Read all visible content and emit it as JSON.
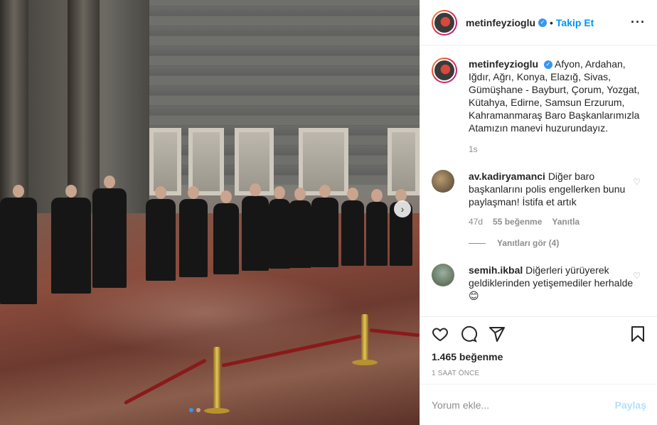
{
  "post": {
    "username": "metinfeyzioglu",
    "follow_label": "Takip Et",
    "more_icon": "more-options-icon",
    "separator": "•"
  },
  "caption": {
    "username": "metinfeyzioglu",
    "text": "Afyon, Ardahan, Iğdır, Ağrı, Konya, Elazığ, Sivas, Gümüşhane - Bayburt, Çorum, Yozgat, Kütahya, Edirne, Samsun Erzurum, Kahramanmaraş Baro Başkanlarımızla Atamızın manevi huzurundayız.",
    "time": "1s"
  },
  "comments": [
    {
      "username": "av.kadiryamanci",
      "text": "Diğer baro başkanlarını polis engellerken bunu paylaşman! İstifa et artık",
      "time": "47d",
      "likes": "55 beğenme",
      "reply_label": "Yanıtla",
      "view_replies": "Yanıtları gör (4)"
    },
    {
      "username": "semih.ikbal",
      "text": "Diğerleri yürüyerek geldiklerinden yetişemediler herhalde 😊"
    }
  ],
  "actions": {
    "like_icon": "heart-icon",
    "comment_icon": "comment-icon",
    "share_icon": "share-icon",
    "save_icon": "bookmark-icon"
  },
  "likes_count": "1.465 beğenme",
  "posted_time": "1 SAAT ÖNCE",
  "add_comment": {
    "placeholder": "Yorum ekle...",
    "post_label": "Paylaş"
  },
  "carousel": {
    "next_icon": "chevron-right-icon",
    "slide_count": 2,
    "active_slide": 1
  },
  "colors": {
    "accent": "#0095f6",
    "verified": "#3897f0",
    "muted": "#8e8e8e",
    "post_disabled": "#b2dffc"
  }
}
